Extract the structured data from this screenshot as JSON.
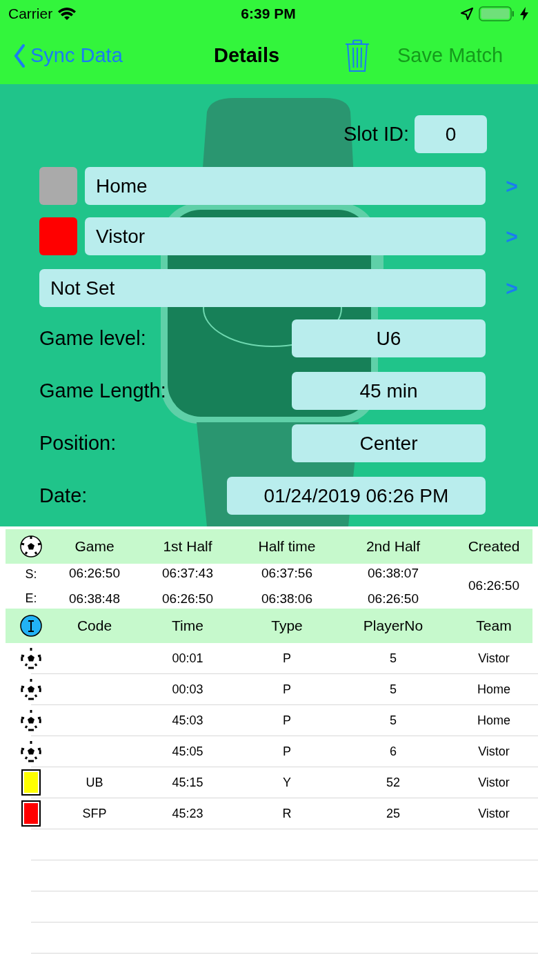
{
  "status_bar": {
    "carrier": "Carrier",
    "time": "6:39 PM"
  },
  "nav": {
    "back": "Sync Data",
    "title": "Details",
    "save": {
      "label": "Save Match",
      "disabled": true
    }
  },
  "slot": {
    "label": "Slot ID:",
    "value": "0"
  },
  "teams": [
    {
      "name": "Home",
      "color": "#aaaaaa",
      "chevron": ">"
    },
    {
      "name": "Vistor",
      "color": "#ff0000",
      "chevron": ">"
    }
  ],
  "selector": {
    "value": "Not Set",
    "chevron": ">"
  },
  "fields": [
    {
      "label": "Game level:",
      "value": "U6"
    },
    {
      "label": "Game Length:",
      "value": "45 min"
    },
    {
      "label": "Position:",
      "value": "Center"
    },
    {
      "label": "Date:",
      "value": "01/24/2019 06:26 PM",
      "wide": true
    }
  ],
  "summary": {
    "columns": [
      "Game",
      "1st Half",
      "Half time",
      "2nd Half",
      "Created"
    ],
    "start": {
      "label": "S:",
      "values": [
        "06:26:50",
        "06:37:43",
        "06:37:56",
        "06:38:07"
      ]
    },
    "end": {
      "label": "E:",
      "values": [
        "06:38:48",
        "06:26:50",
        "06:38:06",
        "06:26:50"
      ]
    },
    "created": "06:26:50"
  },
  "events": {
    "columns": [
      "Code",
      "Time",
      "Type",
      "PlayerNo",
      "Team"
    ],
    "rows": [
      {
        "kind": "goal",
        "code": "",
        "time": "00:01",
        "type": "P",
        "player": "5",
        "team": "Vistor"
      },
      {
        "kind": "goal",
        "code": "",
        "time": "00:03",
        "type": "P",
        "player": "5",
        "team": "Home"
      },
      {
        "kind": "goal",
        "code": "",
        "time": "45:03",
        "type": "P",
        "player": "5",
        "team": "Home"
      },
      {
        "kind": "goal",
        "code": "",
        "time": "45:05",
        "type": "P",
        "player": "6",
        "team": "Vistor"
      },
      {
        "kind": "card",
        "color": "#ffff00",
        "code": "UB",
        "time": "45:15",
        "type": "Y",
        "player": "52",
        "team": "Vistor"
      },
      {
        "kind": "card",
        "color": "#ff0000",
        "code": "SFP",
        "time": "45:23",
        "type": "R",
        "player": "25",
        "team": "Vistor"
      }
    ]
  }
}
